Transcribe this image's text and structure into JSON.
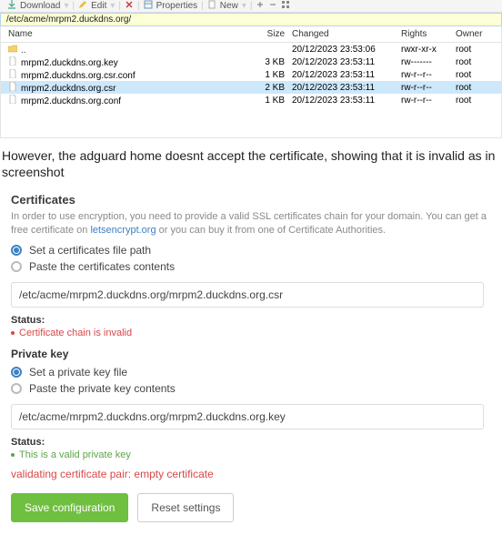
{
  "toolbar": {
    "download": "Download",
    "edit": "Edit",
    "properties": "Properties",
    "new": "New"
  },
  "address_bar": {
    "path": "/etc/acme/mrpm2.duckdns.org/"
  },
  "file_header": {
    "name": "Name",
    "size": "Size",
    "changed": "Changed",
    "rights": "Rights",
    "owner": "Owner"
  },
  "file_rows": {
    "up": {
      "name": "..",
      "size": "",
      "changed": "20/12/2023 23:53:06",
      "rights": "rwxr-xr-x",
      "owner": "root"
    },
    "r0": {
      "name": "mrpm2.duckdns.org.key",
      "size": "3 KB",
      "changed": "20/12/2023 23:53:11",
      "rights": "rw-------",
      "owner": "root"
    },
    "r1": {
      "name": "mrpm2.duckdns.org.csr.conf",
      "size": "1 KB",
      "changed": "20/12/2023 23:53:11",
      "rights": "rw-r--r--",
      "owner": "root"
    },
    "r2": {
      "name": "mrpm2.duckdns.org.csr",
      "size": "2 KB",
      "changed": "20/12/2023 23:53:11",
      "rights": "rw-r--r--",
      "owner": "root"
    },
    "r3": {
      "name": "mrpm2.duckdns.org.conf",
      "size": "1 KB",
      "changed": "20/12/2023 23:53:11",
      "rights": "rw-r--r--",
      "owner": "root"
    }
  },
  "body_text": "However, the adguard home doesnt accept the certificate, showing that it is invalid as in screenshot",
  "cert": {
    "heading": "Certificates",
    "desc_a": "In order to use encryption, you need to provide a valid SSL certificates chain for your domain. You can get a free certificate on ",
    "link": "letsencrypt.org",
    "desc_b": " or you can buy it from one of Certificate Authorities.",
    "radio_path": "Set a certificates file path",
    "radio_paste": "Paste the certificates contents",
    "input": "/etc/acme/mrpm2.duckdns.org/mrpm2.duckdns.org.csr",
    "status_label": "Status:",
    "status_line": "Certificate chain is invalid"
  },
  "key": {
    "heading": "Private key",
    "radio_path": "Set a private key file",
    "radio_paste": "Paste the private key contents",
    "input": "/etc/acme/mrpm2.duckdns.org/mrpm2.duckdns.org.key",
    "status_label": "Status:",
    "status_line": "This is a valid private key"
  },
  "pair_error": "validating certificate pair: empty certificate",
  "buttons": {
    "save": "Save configuration",
    "reset": "Reset settings"
  }
}
